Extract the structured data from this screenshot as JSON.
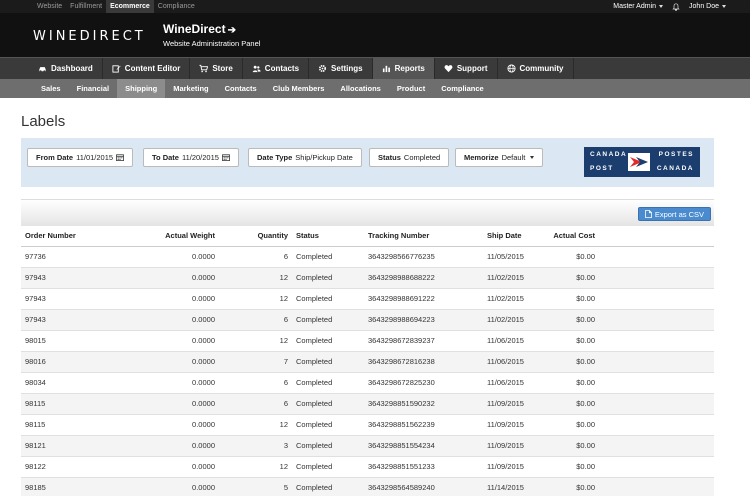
{
  "topbar": {
    "links": [
      {
        "label": "Website",
        "active": false
      },
      {
        "label": "Fulfillment",
        "active": false
      },
      {
        "label": "Ecommerce",
        "active": true
      },
      {
        "label": "Compliance",
        "active": false
      }
    ],
    "admin_label": "Master Admin",
    "user_label": "John Doe"
  },
  "header": {
    "logo": "WINEDIRECT",
    "brand_name": "WineDirect",
    "brand_arrow": "➔",
    "subtitle": "Website Administration Panel"
  },
  "main_nav": [
    {
      "label": "Dashboard",
      "icon": "car-icon",
      "active": false
    },
    {
      "label": "Content Editor",
      "icon": "edit-icon",
      "active": false
    },
    {
      "label": "Store",
      "icon": "cart-icon",
      "active": false
    },
    {
      "label": "Contacts",
      "icon": "users-icon",
      "active": false
    },
    {
      "label": "Settings",
      "icon": "gear-icon",
      "active": false
    },
    {
      "label": "Reports",
      "icon": "bar-chart-icon",
      "active": true
    },
    {
      "label": "Support",
      "icon": "heart-icon",
      "active": false
    },
    {
      "label": "Community",
      "icon": "globe-icon",
      "active": false
    }
  ],
  "sub_nav": [
    {
      "label": "Sales",
      "active": false
    },
    {
      "label": "Financial",
      "active": false
    },
    {
      "label": "Shipping",
      "active": true
    },
    {
      "label": "Marketing",
      "active": false
    },
    {
      "label": "Contacts",
      "active": false
    },
    {
      "label": "Club Members",
      "active": false
    },
    {
      "label": "Allocations",
      "active": false
    },
    {
      "label": "Product",
      "active": false
    },
    {
      "label": "Compliance",
      "active": false
    }
  ],
  "page_title": "Labels",
  "filters": {
    "from_date_label": "From Date",
    "from_date_value": "11/01/2015",
    "to_date_label": "To Date",
    "to_date_value": "11/20/2015",
    "date_type_label": "Date Type",
    "date_type_value": "Ship/Pickup Date",
    "status_label": "Status",
    "status_value": "Completed",
    "memorize_label": "Memorize",
    "memorize_value": "Default"
  },
  "carrier_logo": {
    "line1_left": "CANADA",
    "line1_right": "POSTES",
    "line2_left": "POST",
    "line2_right": "CANADA",
    "color": "#1c3e6e",
    "accent": "#e22b2b"
  },
  "export_label": "Export as CSV",
  "table": {
    "headers": [
      "Order Number",
      "Actual Weight",
      "Quantity",
      "Status",
      "Tracking Number",
      "Ship Date",
      "Actual Cost"
    ],
    "rows": [
      [
        "97736",
        "0.0000",
        "6",
        "Completed",
        "3643298566776235",
        "11/05/2015",
        "$0.00"
      ],
      [
        "97943",
        "0.0000",
        "12",
        "Completed",
        "3643298988688222",
        "11/02/2015",
        "$0.00"
      ],
      [
        "97943",
        "0.0000",
        "12",
        "Completed",
        "3643298988691222",
        "11/02/2015",
        "$0.00"
      ],
      [
        "97943",
        "0.0000",
        "6",
        "Completed",
        "3643298988694223",
        "11/02/2015",
        "$0.00"
      ],
      [
        "98015",
        "0.0000",
        "12",
        "Completed",
        "3643298672839237",
        "11/06/2015",
        "$0.00"
      ],
      [
        "98016",
        "0.0000",
        "7",
        "Completed",
        "3643298672816238",
        "11/06/2015",
        "$0.00"
      ],
      [
        "98034",
        "0.0000",
        "6",
        "Completed",
        "3643298672825230",
        "11/06/2015",
        "$0.00"
      ],
      [
        "98115",
        "0.0000",
        "6",
        "Completed",
        "3643298851590232",
        "11/09/2015",
        "$0.00"
      ],
      [
        "98115",
        "0.0000",
        "12",
        "Completed",
        "3643298851562239",
        "11/09/2015",
        "$0.00"
      ],
      [
        "98121",
        "0.0000",
        "3",
        "Completed",
        "3643298851554234",
        "11/09/2015",
        "$0.00"
      ],
      [
        "98122",
        "0.0000",
        "12",
        "Completed",
        "3643298851551233",
        "11/09/2015",
        "$0.00"
      ],
      [
        "98185",
        "0.0000",
        "5",
        "Completed",
        "3643298564589240",
        "11/14/2015",
        "$0.00"
      ]
    ]
  }
}
